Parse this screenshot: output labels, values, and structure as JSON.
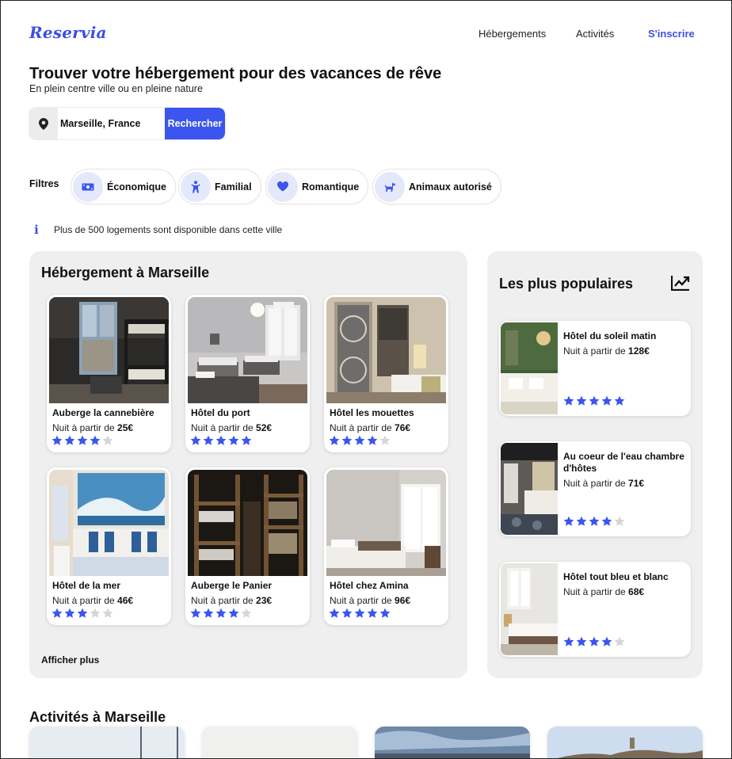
{
  "header": {
    "logo": "Reservia",
    "nav": [
      "Hébergements",
      "Activités"
    ],
    "signup": "S'inscrire"
  },
  "hero": {
    "title": "Trouver votre hébergement pour des vacances de rêve",
    "subtitle": "En plein centre ville ou en pleine nature"
  },
  "search": {
    "icon": "map-pin-icon",
    "value": "Marseille, France",
    "button": "Rechercher"
  },
  "filters": {
    "label": "Filtres",
    "items": [
      {
        "label": "Économique",
        "icon": "money-icon"
      },
      {
        "label": "Familial",
        "icon": "child-icon"
      },
      {
        "label": "Romantique",
        "icon": "heart-icon"
      },
      {
        "label": "Animaux autorisé",
        "icon": "dog-icon"
      }
    ]
  },
  "info": {
    "icon": "info-icon",
    "text": "Plus de 500 logements sont disponible dans cette ville"
  },
  "accommodations": {
    "title": "Hébergement à Marseille",
    "price_prefix": "Nuit à partir de",
    "items": [
      {
        "name": "Auberge la cannebière",
        "price": "25€",
        "rating": 4
      },
      {
        "name": "Hôtel du port",
        "price": "52€",
        "rating": 5
      },
      {
        "name": "Hôtel les mouettes",
        "price": "76€",
        "rating": 4
      },
      {
        "name": "Hôtel de la mer",
        "price": "46€",
        "rating": 3
      },
      {
        "name": "Auberge le Panier",
        "price": "23€",
        "rating": 4
      },
      {
        "name": "Hôtel chez Amina",
        "price": "96€",
        "rating": 5
      }
    ],
    "show_more": "Afficher plus"
  },
  "popular": {
    "title": "Les plus populaires",
    "icon": "trending-up-icon",
    "price_prefix": "Nuit à partir de",
    "items": [
      {
        "name": "Hôtel du soleil matin",
        "price": "128€",
        "rating": 5
      },
      {
        "name": "Au coeur de l'eau chambre d'hôtes",
        "price": "71€",
        "rating": 4
      },
      {
        "name": "Hôtel tout bleu et blanc",
        "price": "68€",
        "rating": 4
      }
    ]
  },
  "activities": {
    "title": "Activités à Marseille"
  },
  "colors": {
    "accent": "#3b55ee",
    "star_on": "#3b55ee",
    "star_off": "#d6d6d6",
    "panel_bg": "#efefef"
  }
}
